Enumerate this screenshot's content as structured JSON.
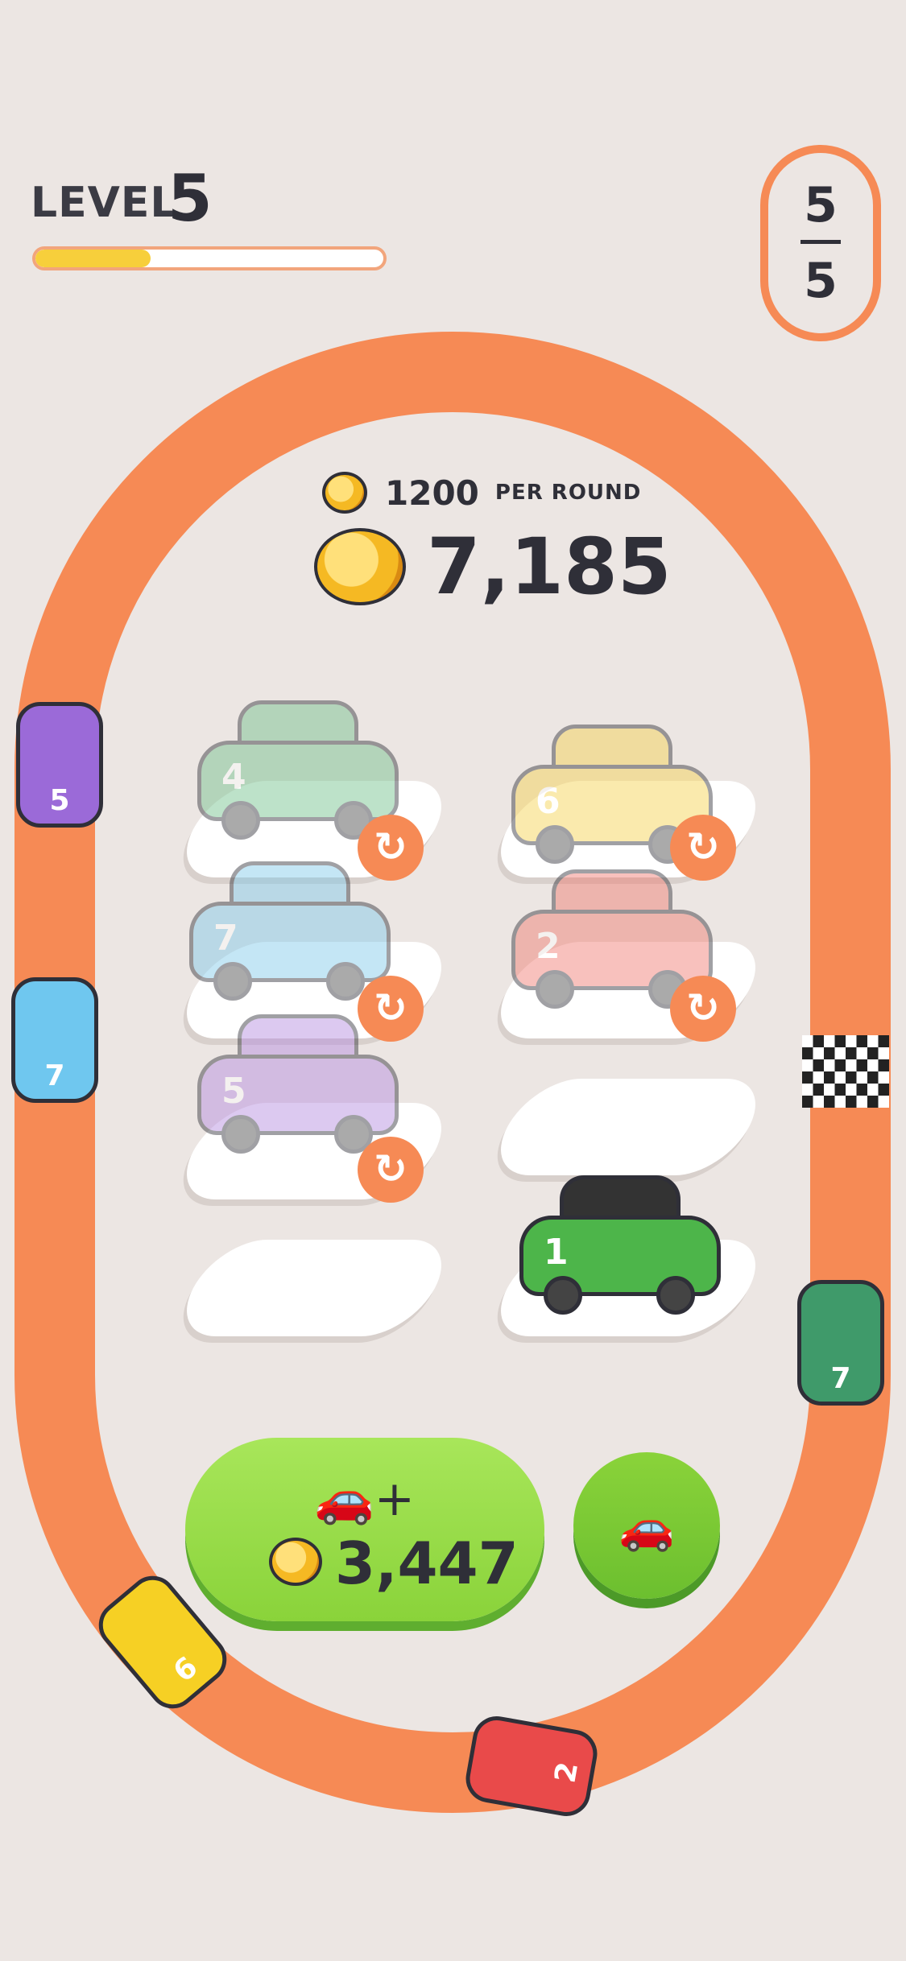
{
  "header": {
    "level_label": "LEVEL",
    "level_number": "5",
    "level_progress": 0.33,
    "laps_current": "5",
    "laps_total": "5"
  },
  "economy": {
    "per_round_value": "1200",
    "per_round_label": "PER ROUND",
    "total_coins": "7,185"
  },
  "slots": [
    {
      "car_number": "4",
      "color": "#6fbf8a",
      "state": "racing"
    },
    {
      "car_number": "6",
      "color": "#f6d24c",
      "state": "racing"
    },
    {
      "car_number": "7",
      "color": "#7dc8ea",
      "state": "racing"
    },
    {
      "car_number": "2",
      "color": "#f0786e",
      "state": "racing"
    },
    {
      "car_number": "5",
      "color": "#b388e0",
      "state": "racing"
    },
    {
      "car_number": "",
      "color": "",
      "state": "empty"
    },
    {
      "car_number": "",
      "color": "",
      "state": "empty"
    },
    {
      "car_number": "1",
      "color": "#4db54a",
      "state": "parked"
    }
  ],
  "track_cars": [
    {
      "number": "5",
      "color": "#9b6ad8"
    },
    {
      "number": "7",
      "color": "#6fc7ef"
    },
    {
      "number": "7",
      "color": "#3f9a6a"
    },
    {
      "number": "6",
      "color": "#f6d024"
    },
    {
      "number": "2",
      "color": "#e94a4a"
    }
  ],
  "buttons": {
    "buy_icon": "add-car-icon",
    "buy_price": "3,447",
    "merge_icon": "cars-group-icon"
  },
  "colors": {
    "track": "#f68a55",
    "background": "#ece6e3",
    "button_green": "#8ad33a"
  }
}
